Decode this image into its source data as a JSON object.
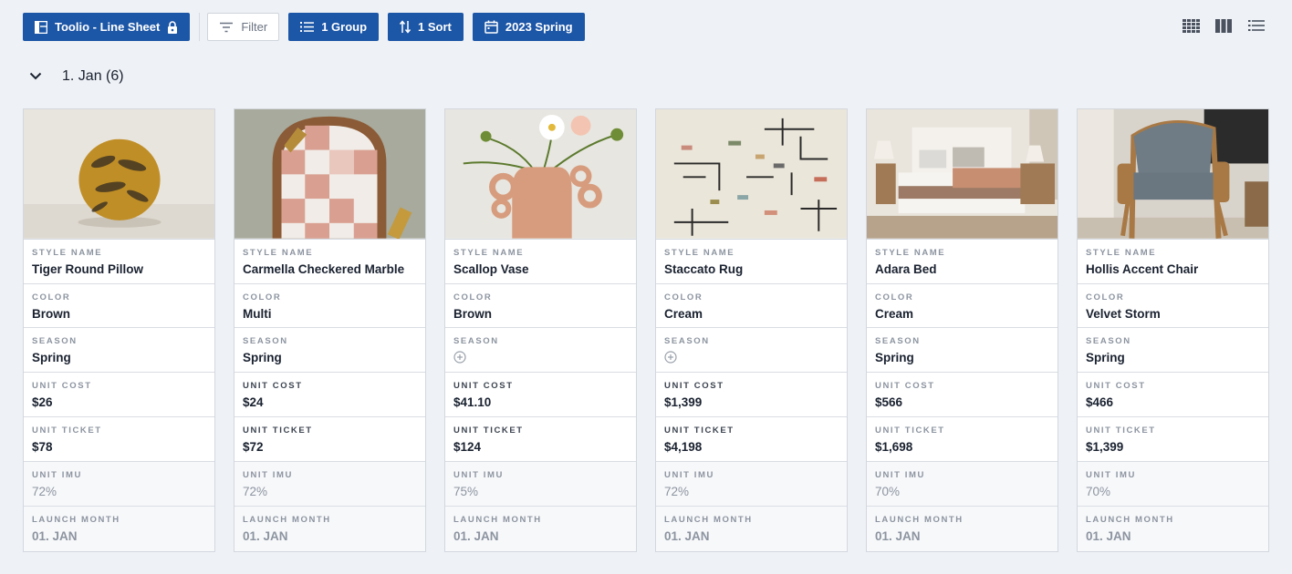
{
  "toolbar": {
    "line_sheet_label": "Toolio - Line Sheet",
    "filter_label": "Filter",
    "group_label": "1 Group",
    "sort_label": "1 Sort",
    "season_label": "2023 Spring"
  },
  "group": {
    "title": "1. Jan (6)"
  },
  "labels": {
    "style_name": "STYLE NAME",
    "color": "COLOR",
    "season": "SEASON",
    "unit_cost": "UNIT COST",
    "unit_ticket": "UNIT TICKET",
    "unit_imu": "UNIT IMU",
    "launch_month": "LAUNCH MONTH"
  },
  "cards": [
    {
      "style_name": "Tiger Round Pillow",
      "color": "Brown",
      "season": "Spring",
      "unit_cost": "$26",
      "unit_ticket": "$78",
      "unit_imu": "72%",
      "launch_month": "01.  JAN"
    },
    {
      "style_name": "Carmella Checkered Marble",
      "color": "Multi",
      "season": "Spring",
      "unit_cost": "$24",
      "unit_ticket": "$72",
      "unit_imu": "72%",
      "launch_month": "01.  JAN"
    },
    {
      "style_name": "Scallop Vase",
      "color": "Brown",
      "season": "",
      "unit_cost": "$41.10",
      "unit_ticket": "$124",
      "unit_imu": "75%",
      "launch_month": "01.  JAN"
    },
    {
      "style_name": "Staccato Rug",
      "color": "Cream",
      "season": "",
      "unit_cost": "$1,399",
      "unit_ticket": "$4,198",
      "unit_imu": "72%",
      "launch_month": "01.  JAN"
    },
    {
      "style_name": "Adara Bed",
      "color": "Cream",
      "season": "Spring",
      "unit_cost": "$566",
      "unit_ticket": "$1,698",
      "unit_imu": "70%",
      "launch_month": "01.  JAN"
    },
    {
      "style_name": "Hollis Accent Chair",
      "color": "Velvet Storm",
      "season": "Spring",
      "unit_cost": "$466",
      "unit_ticket": "$1,399",
      "unit_imu": "70%",
      "launch_month": "01.  JAN"
    }
  ],
  "icons": {
    "line_sheet": "layout-icon",
    "lock": "lock-icon",
    "filter": "filter-icon",
    "group": "list-icon",
    "sort": "sort-icon",
    "calendar": "calendar-icon",
    "collapse": "chevron-down-icon",
    "grid_view": "grid-view-icon",
    "column_view": "column-view-icon",
    "list_view": "list-view-icon",
    "add": "plus-circle-icon"
  },
  "colors": {
    "primary": "#1c56a6",
    "background": "#eef1f5"
  }
}
